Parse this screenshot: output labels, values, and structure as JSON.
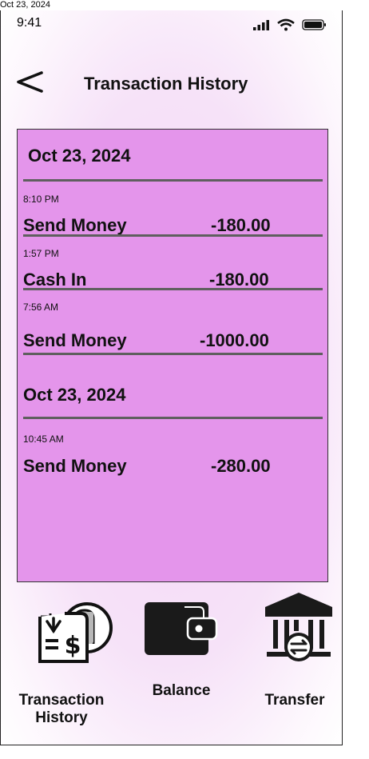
{
  "document": {
    "date_stamp": "Oct 23, 2024"
  },
  "status_bar": {
    "time": "9:41"
  },
  "header": {
    "title": "Transaction History"
  },
  "transactions": {
    "groups": [
      {
        "date": "Oct 23, 2024",
        "items": [
          {
            "time": "8:10 PM",
            "type": "Send Money",
            "amount": "-180.00"
          },
          {
            "time": "1:57 PM",
            "type": "Cash In",
            "amount": "-180.00"
          },
          {
            "time": "7:56 AM",
            "type": "Send Money",
            "amount": "-1000.00"
          }
        ]
      },
      {
        "date": "Oct 23, 2024",
        "items": [
          {
            "time": "10:45 AM",
            "type": "Send Money",
            "amount": "-280.00"
          }
        ]
      }
    ]
  },
  "bottom_nav": {
    "items": [
      {
        "label": "Transaction History",
        "icon": "receipt-dollar-icon"
      },
      {
        "label": "Balance",
        "icon": "wallet-icon"
      },
      {
        "label": "Transfer",
        "icon": "bank-transfer-icon"
      }
    ]
  },
  "colors": {
    "panel_bg": "#e495eb",
    "divider": "#5f5f5f",
    "text": "#111111"
  }
}
